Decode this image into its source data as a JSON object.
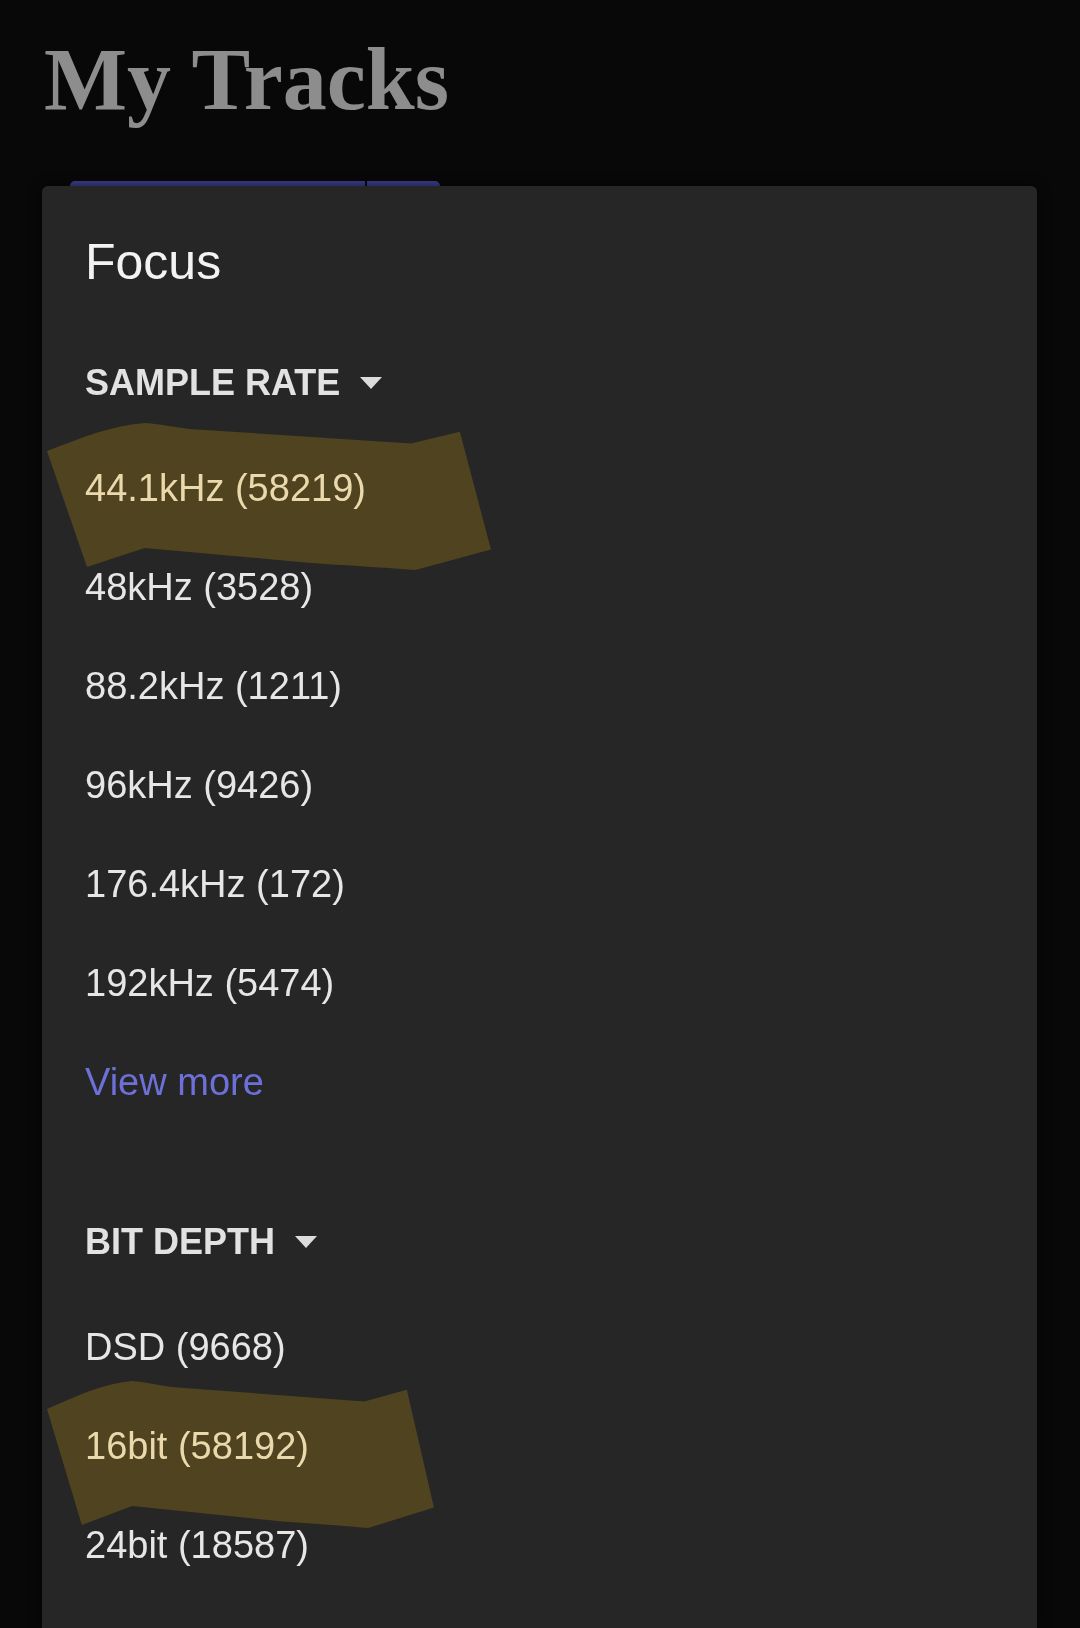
{
  "page": {
    "title": "My Tracks"
  },
  "focus_panel": {
    "title": "Focus",
    "sections": [
      {
        "heading": "SAMPLE RATE",
        "expanded": true,
        "options": [
          {
            "label": "44.1kHz (58219)",
            "highlighted": true
          },
          {
            "label": "48kHz (3528)",
            "highlighted": false
          },
          {
            "label": "88.2kHz (1211)",
            "highlighted": false
          },
          {
            "label": "96kHz (9426)",
            "highlighted": false
          },
          {
            "label": "176.4kHz (172)",
            "highlighted": false
          },
          {
            "label": "192kHz (5474)",
            "highlighted": false
          }
        ],
        "view_more": "View more"
      },
      {
        "heading": "BIT DEPTH",
        "expanded": true,
        "options": [
          {
            "label": "DSD (9668)",
            "highlighted": false
          },
          {
            "label": "16bit (58192)",
            "highlighted": true
          },
          {
            "label": "24bit (18587)",
            "highlighted": false
          }
        ]
      }
    ]
  }
}
